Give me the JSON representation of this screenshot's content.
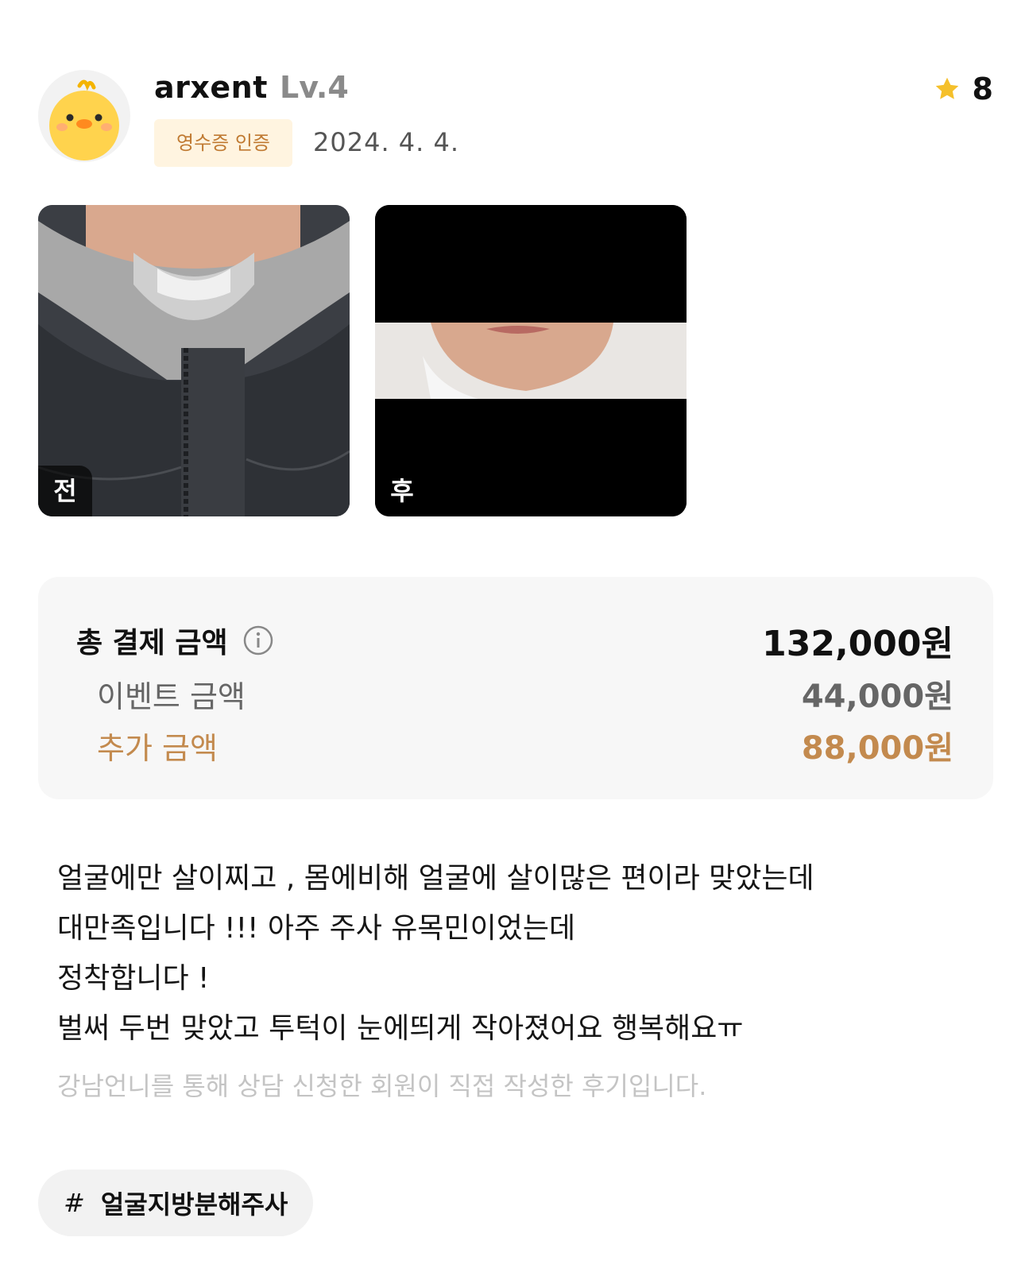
{
  "user": {
    "username": "arxent",
    "level": "Lv.4",
    "badge": "영수증 인증",
    "date": "2024. 4. 4."
  },
  "likes": {
    "count": "8",
    "icon": "star-icon",
    "color": "#f5c02b"
  },
  "photos": {
    "before_label": "전",
    "after_label": "후"
  },
  "payment": {
    "total_label": "총 결제 금액",
    "total_value": "132,000원",
    "event_label": "이벤트 금액",
    "event_value": "44,000원",
    "extra_label": "추가 금액",
    "extra_value": "88,000원",
    "accent_color": "#c38a4e"
  },
  "review": {
    "lines": [
      "얼굴에만 살이찌고 , 몸에비해 얼굴에 살이많은 편이라 맞았는데",
      "대만족입니다 !!! 아주 주사 유목민이었는데",
      "정착합니다 !",
      "벌써 두번 맞았고 투턱이 눈에띄게 작아졌어요 행복해요ㅠ"
    ],
    "disclaimer": "강남언니를 통해 상담 신청한 회원이 직접 작성한 후기입니다."
  },
  "tag": {
    "hash": "#",
    "label": "얼굴지방분해주사"
  }
}
